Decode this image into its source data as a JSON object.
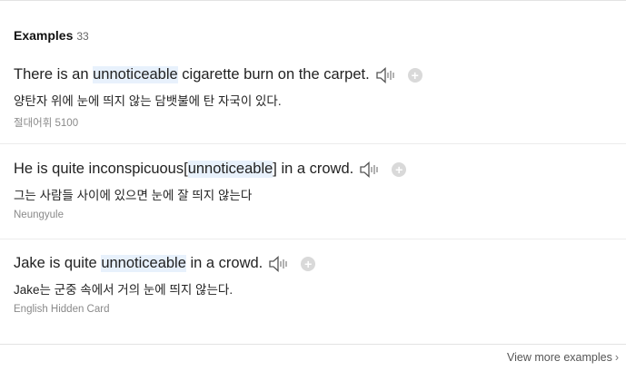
{
  "header": {
    "title": "Examples",
    "count": "33"
  },
  "examples": [
    {
      "en_before": "There is an ",
      "en_highlight": "unnoticeable",
      "en_after": " cigarette burn on the carpet.",
      "ko": "양탄자 위에 눈에 띄지 않는 담뱃불에 탄 자국이 있다.",
      "source": "절대어휘 5100"
    },
    {
      "en_before": "He is quite inconspicuous[",
      "en_highlight": "unnoticeable",
      "en_after": "] in a crowd.",
      "ko": "그는 사람들 사이에 있으면 눈에 잘 띄지 않는다",
      "source": "Neungyule"
    },
    {
      "en_before": "Jake is quite ",
      "en_highlight": "unnoticeable",
      "en_after": " in a crowd.",
      "ko": "Jake는 군중 속에서 거의 눈에 띄지 않는다.",
      "source": "English Hidden Card"
    }
  ],
  "icons": {
    "speaker": "speaker-icon",
    "add": "add-icon",
    "chevron": "chevron-right-icon"
  },
  "footer": {
    "more_label": "View more examples",
    "chevron": "›"
  },
  "colors": {
    "highlight": "#e8f1fc",
    "add_circle": "#d9d9d9",
    "source_text": "#8a8a8a"
  }
}
